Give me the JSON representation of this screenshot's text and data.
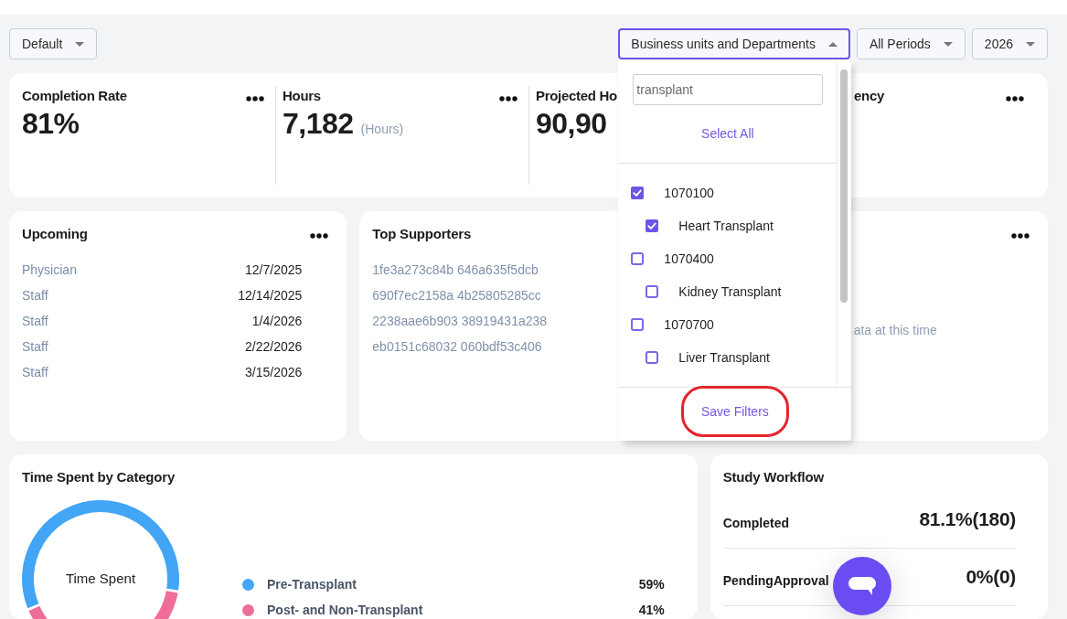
{
  "toolbar": {
    "view_select": {
      "label": "Default",
      "expanded": false
    },
    "filters": [
      {
        "label": "Business units and Departments",
        "expanded": true,
        "panel": {
          "search": {
            "value": "transplant"
          },
          "select_all": "Select All",
          "items": [
            {
              "label": "1070100",
              "checked": true,
              "children": [
                {
                  "label": "Heart Transplant",
                  "checked": true
                }
              ]
            },
            {
              "label": "1070400",
              "checked": false,
              "children": [
                {
                  "label": "Kidney Transplant",
                  "checked": false
                }
              ]
            },
            {
              "label": "1070700",
              "checked": false,
              "children": [
                {
                  "label": "Liver Transplant",
                  "checked": false
                }
              ]
            }
          ],
          "save_button": {
            "label": "Save Filters",
            "highlighted": true
          }
        }
      },
      {
        "label": "All Periods",
        "expanded": false
      },
      {
        "label": "2026",
        "expanded": false
      }
    ]
  },
  "metrics": [
    {
      "title": "Completion Rate",
      "value": "81%",
      "menu": true
    },
    {
      "title": "Hours",
      "value": "7,182",
      "unit": "(Hours)",
      "menu": true
    },
    {
      "title": "Projected Ho",
      "value": "90,90",
      "menu": false
    },
    {
      "title": "ency",
      "menu": true
    }
  ],
  "upcoming": {
    "title": "Upcoming",
    "menu": true,
    "rows": [
      {
        "role": "Physician",
        "date": "12/7/2025"
      },
      {
        "role": "Staff",
        "date": "12/14/2025"
      },
      {
        "role": "Staff",
        "date": "1/4/2026"
      },
      {
        "role": "Staff",
        "date": "2/22/2026"
      },
      {
        "role": "Staff",
        "date": "3/15/2026"
      }
    ]
  },
  "top_supporters": {
    "title": "Top Supporters",
    "menu": false,
    "names": [
      "1fe3a273c84b 646a635f5dcb",
      "690f7ec2158a 4b25805285cc",
      "2238aae6b903 38919431a238",
      "eb0151c68032 060bdf53c406"
    ]
  },
  "card_3": {
    "menu": true,
    "message": "ata at this time"
  },
  "time_spent": {
    "title": "Time Spent by Category",
    "chart_data": {
      "type": "donut",
      "title": "Time Spent",
      "categories": [
        "Pre-Transplant",
        "Post- and Non-Transplant"
      ],
      "values": [
        59,
        41
      ]
    },
    "legend": [
      {
        "color": "#42a5f5",
        "share": "59%"
      },
      {
        "color": "#ee6e99",
        "share": "41%"
      }
    ]
  },
  "study_workflow": {
    "title": "Study Workflow",
    "rows": [
      {
        "label": "Completed",
        "value": "81.1%(180)"
      },
      {
        "label": "PendingApproval",
        "value": "0%(0)"
      }
    ]
  }
}
